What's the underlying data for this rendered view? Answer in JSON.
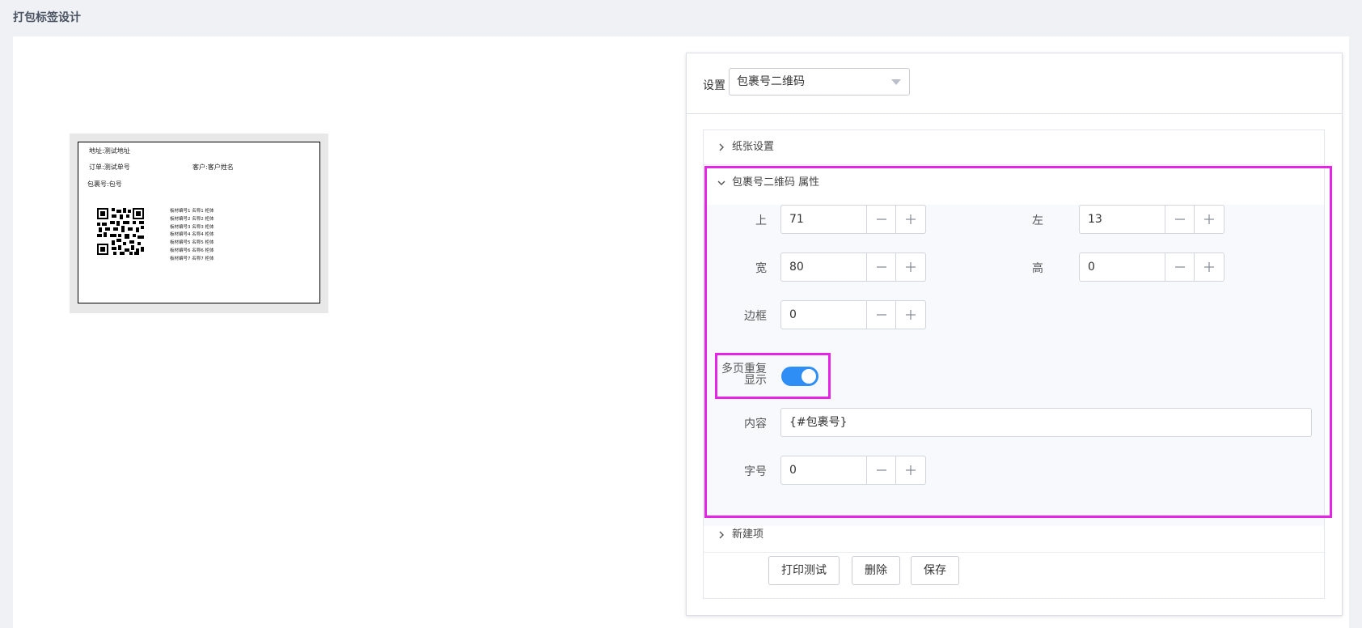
{
  "page": {
    "title": "打包标签设计"
  },
  "preview": {
    "address": "地址:测试地址",
    "order": "订单:测试单号",
    "customer": "客户:客户姓名",
    "package": "包裹号:包号",
    "items": [
      "板材编号1 名称1 柜体",
      "板材编号2 名称2 柜体",
      "板材编号3 名称3 柜体",
      "板材编号4 名称4 柜体",
      "板材编号5 名称5 柜体",
      "板材编号6 名称6 柜体",
      "板材编号7 名称7 柜体"
    ]
  },
  "settings": {
    "label": "设置",
    "selected": "包裹号二维码",
    "sections": {
      "paper": "纸张设置",
      "props": "包裹号二维码 属性",
      "new_item": "新建项"
    },
    "fields": {
      "top": {
        "label": "上",
        "value": "71"
      },
      "left": {
        "label": "左",
        "value": "13"
      },
      "width": {
        "label": "宽",
        "value": "80"
      },
      "height": {
        "label": "高",
        "value": "0"
      },
      "border": {
        "label": "边框",
        "value": "0"
      },
      "repeat": {
        "label_line1": "多页重复",
        "label_line2": "显示",
        "on": true
      },
      "content": {
        "label": "内容",
        "value": "{#包裹号}"
      },
      "font_size": {
        "label": "字号",
        "value": "0"
      }
    },
    "buttons": {
      "print_test": "打印测试",
      "delete": "删除",
      "save": "保存"
    }
  },
  "colors": {
    "accent": "#2f8ef6",
    "highlight": "#e623e6"
  }
}
